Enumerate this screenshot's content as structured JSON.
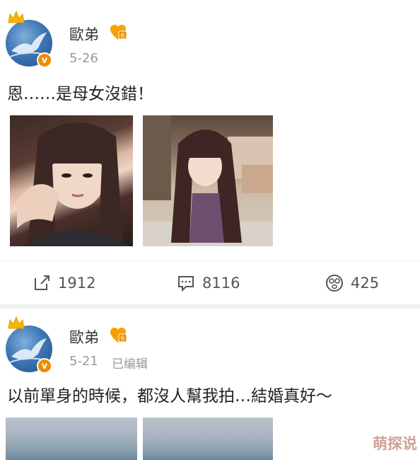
{
  "posts": [
    {
      "author": "歐弟",
      "time": "5-26",
      "edited": "",
      "text": "恩……是母女沒錯！",
      "images": [
        "woman-portrait",
        "child-portrait"
      ],
      "actions": {
        "repost": "1912",
        "comment": "8116",
        "like": "425"
      }
    },
    {
      "author": "歐弟",
      "time": "5-21",
      "edited": "已编辑",
      "text": "以前單身的時候，都沒人幫我拍…結婚真好～",
      "images": [
        "sea-horizon",
        "sea-horizon"
      ]
    }
  ],
  "icons": {
    "crown": "crown-icon",
    "verified": "v",
    "vip": "vip-badge-icon",
    "repost": "repost-icon",
    "comment": "comment-icon",
    "like": "like-icon"
  },
  "watermark": "萌探说",
  "colors": {
    "accent": "#f08c00",
    "muted": "#999999",
    "text": "#222222"
  }
}
